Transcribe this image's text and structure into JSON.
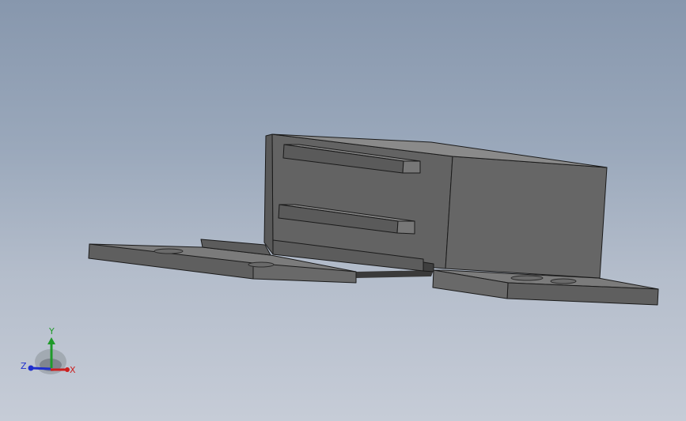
{
  "viewport": {
    "background_top": "#8797ad",
    "background_bottom": "#c6ccd7"
  },
  "model": {
    "face_dark": "#5e5e5e",
    "face_mid": "#666666",
    "face_light": "#7a7a7a",
    "face_top": "#8a8a8a",
    "edge": "#1a1a1a"
  },
  "triad": {
    "x_label": "X",
    "y_label": "Y",
    "z_label": "Z",
    "x_color": "#cc1f1f",
    "y_color": "#1f9a2a",
    "z_color": "#1f2fcc"
  }
}
